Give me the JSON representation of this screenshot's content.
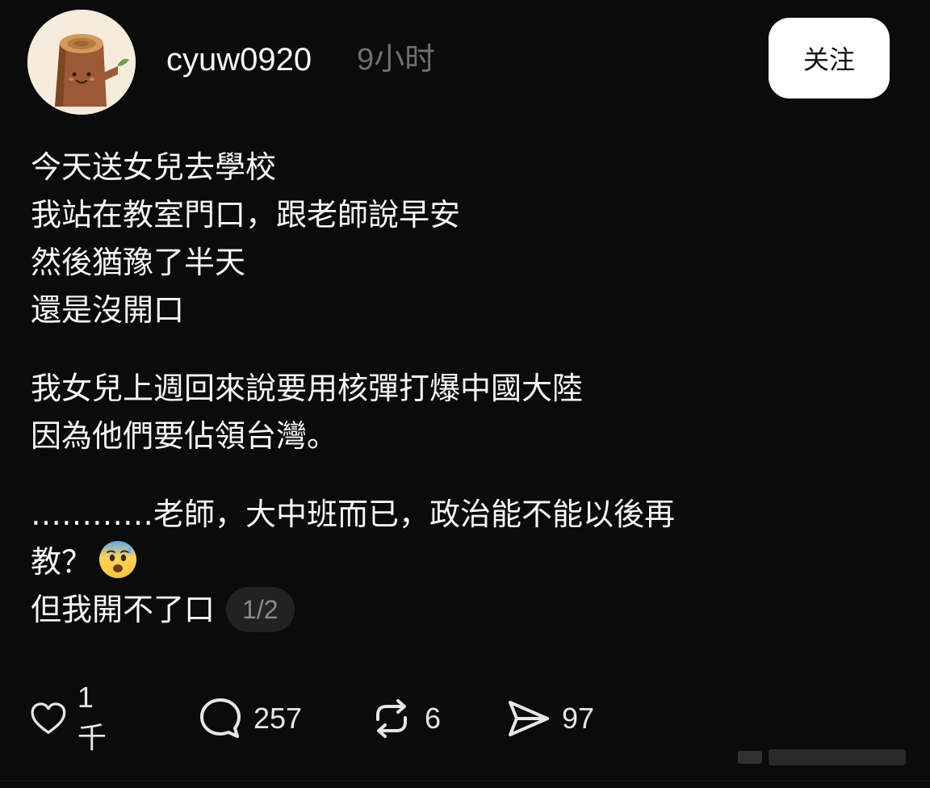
{
  "post": {
    "username": "cyuw0920",
    "time_ago": "9小时",
    "follow_label": "关注",
    "lines_p1": [
      "今天送女兒去學校",
      "我站在教室門口，跟老師說早安",
      "然後猶豫了半天",
      "還是沒開口"
    ],
    "lines_p2": [
      "我女兒上週回來說要用核彈打爆中國大陸",
      "因為他們要佔領台灣。"
    ],
    "lines_p3": [
      "…………老師，大中班而已，政治能不能以後再",
      "教？",
      "但我開不了口"
    ],
    "page_indicator": "1/2"
  },
  "actions": {
    "likes": "1千",
    "comments": "257",
    "reposts": "6",
    "shares": "97"
  },
  "icons": [
    "avatar-stump",
    "anxious-face-emoji",
    "heart-icon",
    "comment-icon",
    "repost-icon",
    "share-icon"
  ],
  "colors": {
    "background": "#0b0b0b",
    "text": "#f6f6f6",
    "muted": "#6f6f6f",
    "button_bg": "#ffffff"
  }
}
